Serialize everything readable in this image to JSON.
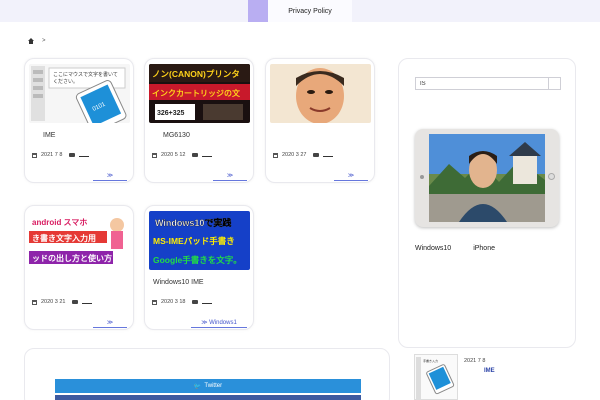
{
  "nav": {
    "privacy_label": "Privacy Policy"
  },
  "breadcrumb": {
    "sep": ">"
  },
  "cards": [
    {
      "title": "IME",
      "date": "2021 7 8",
      "more": "≫",
      "thumb_text": "ここにマウスで文字を書いて\nください。"
    },
    {
      "title": "MG6130",
      "date": "2020 5 12",
      "more": "≫",
      "thumb_text_1": "キャノン(CANON)プリンタ",
      "thumb_text_2": "インクカートリッジの文字",
      "thumb_text_3": "326+325"
    },
    {
      "title": "",
      "date": "2020 3 27",
      "more": "≫"
    },
    {
      "title": "",
      "date": "2020 3 21",
      "more": "≫",
      "thumb_text_1": "Android スマホ",
      "thumb_text_2": "き書き文字入力用",
      "thumb_text_3": "ッドの出し方と使い方"
    },
    {
      "title": "Windows10   IME",
      "date": "2020 3 18",
      "more": "≫ Windows1",
      "thumb_text_1": "Windows10で実践",
      "thumb_text_2": "MS-IMEパッド手書き",
      "thumb_text_3": "Google手書きを文字。"
    }
  ],
  "sidebar": {
    "search_value": "IS",
    "tags": [
      "Windows10",
      "iPhone"
    ]
  },
  "share": {
    "twitter_label": "Twitter"
  },
  "recent": {
    "date": "2021 7 8",
    "title": "IME",
    "thumb_label": "手書き入力"
  },
  "colors": {
    "accent": "#b9aef2",
    "link": "#4455cc",
    "twitter": "#2a90da",
    "facebook": "#3d5aa0"
  }
}
